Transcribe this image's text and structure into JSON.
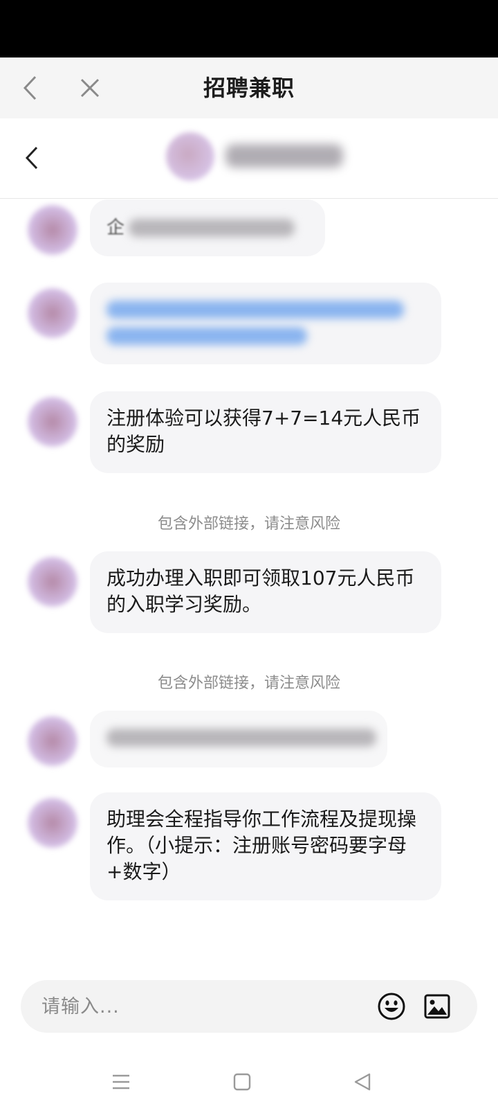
{
  "web_bar": {
    "title": "招聘兼职",
    "back_icon": "chevron-left-icon",
    "close_icon": "close-icon"
  },
  "chat_header": {
    "back_icon": "chevron-left-icon"
  },
  "messages": [
    {
      "type": "blurred",
      "first_char": "企",
      "color": "gray"
    },
    {
      "type": "blurred",
      "color": "blue"
    },
    {
      "type": "text",
      "text": "注册体验可以获得7+7=14元人民币的奖励"
    },
    {
      "type": "notice",
      "text": "包含外部链接，请注意风险"
    },
    {
      "type": "text",
      "text": "成功办理入职即可领取107元人民币的入职学习奖励。"
    },
    {
      "type": "notice",
      "text": "包含外部链接，请注意风险"
    },
    {
      "type": "blurred",
      "color": "gray"
    },
    {
      "type": "text",
      "text": "助理会全程指导你工作流程及提现操作。（小提示：注册账号密码要字母+数字）"
    }
  ],
  "input": {
    "placeholder": "请输入...",
    "emoji_icon": "emoji-icon",
    "image_icon": "image-icon"
  },
  "nav": {
    "menu_icon": "menu-icon",
    "home_icon": "home-square-icon",
    "back_icon": "back-triangle-icon"
  }
}
